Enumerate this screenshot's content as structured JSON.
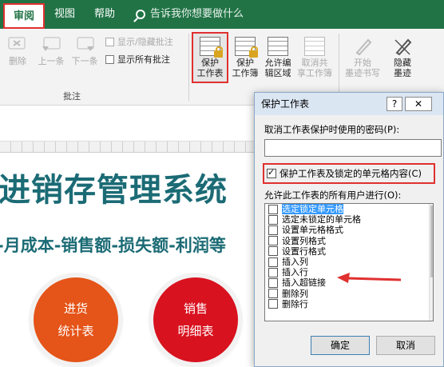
{
  "tabs": {
    "review": "审阅",
    "view": "视图",
    "help": "帮助"
  },
  "tellme": {
    "text": "告诉我你想要做什么"
  },
  "ribbon": {
    "delete": "删除",
    "prev": "上一条",
    "next": "下一条",
    "show_hide_comment": "显示/隐藏批注",
    "show_all_comments": "显示所有批注",
    "comments_group": "批注",
    "protect_sheet": [
      "保护",
      "工作表"
    ],
    "protect_workbook": [
      "保护",
      "工作簿"
    ],
    "allow_edit": [
      "允许编",
      "辑区域"
    ],
    "unshare": [
      "取消共",
      "享工作簿"
    ],
    "start_ink": [
      "开始",
      "墨迹书写"
    ],
    "hide_ink": [
      "隐藏",
      "墨迹"
    ]
  },
  "sheet": {
    "title": "进销存管理系统",
    "subtitle": "-月成本-销售额-损失额-利润等",
    "circle1": [
      "进货",
      "统计表"
    ],
    "circle2": [
      "销售",
      "明细表"
    ]
  },
  "dialog": {
    "title": "保护工作表",
    "help": "?",
    "close": "✕",
    "pwd_label": "取消工作表保护时使用的密码(P):",
    "pwd_value": "",
    "protect_label": "保护工作表及锁定的单元格内容(C)",
    "protect_checked": true,
    "allow_label": "允许此工作表的所有用户进行(O):",
    "permissions": [
      {
        "label": "选定锁定单元格",
        "checked": false
      },
      {
        "label": "选定未锁定的单元格",
        "checked": false
      },
      {
        "label": "设置单元格格式",
        "checked": false
      },
      {
        "label": "设置列格式",
        "checked": false
      },
      {
        "label": "设置行格式",
        "checked": false
      },
      {
        "label": "插入列",
        "checked": false
      },
      {
        "label": "插入行",
        "checked": false
      },
      {
        "label": "插入超链接",
        "checked": false
      },
      {
        "label": "删除列",
        "checked": false
      },
      {
        "label": "删除行",
        "checked": false
      }
    ],
    "ok": "确定",
    "cancel": "取消"
  },
  "colors": {
    "ribbon_green": "#217346",
    "title_teal": "#1b6b75",
    "orange": "#e55418",
    "red": "#d9121f",
    "highlight": "#e03030"
  }
}
